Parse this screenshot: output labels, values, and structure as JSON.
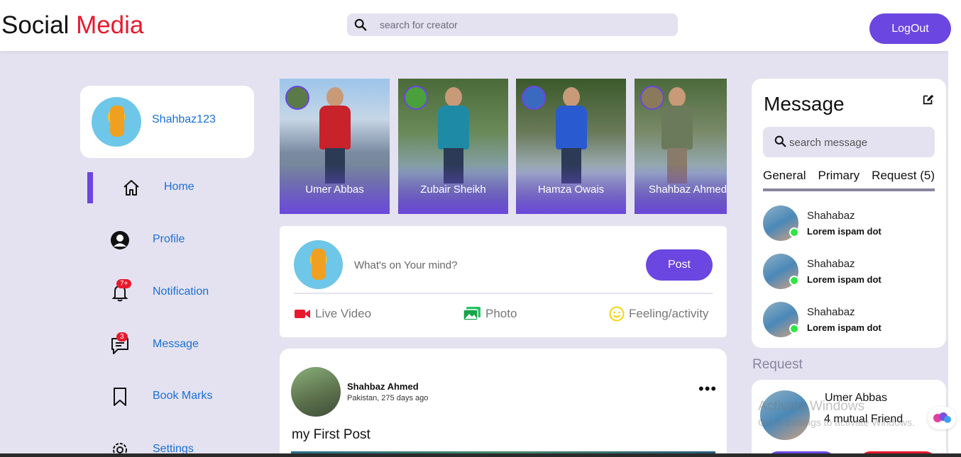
{
  "brand": {
    "part1": "Social",
    "part2": "Media"
  },
  "search": {
    "placeholder": "search for creator"
  },
  "header": {
    "logout_label": "LogOut"
  },
  "profile": {
    "username": "Shahbaz123"
  },
  "sidebar": {
    "items": [
      {
        "label": "Home",
        "icon": "home-icon",
        "active": true
      },
      {
        "label": "Profile",
        "icon": "user-icon"
      },
      {
        "label": "Notification",
        "icon": "bell-icon",
        "badge": "7+"
      },
      {
        "label": "Message",
        "icon": "chat-icon",
        "badge": "3"
      },
      {
        "label": "Book Marks",
        "icon": "bookmark-icon"
      },
      {
        "label": "Settings",
        "icon": "gear-icon"
      }
    ]
  },
  "stories": [
    {
      "name": "Umer Abbas"
    },
    {
      "name": "Zubair Sheikh"
    },
    {
      "name": "Hamza Owais"
    },
    {
      "name": "Shahbaz Ahmed"
    }
  ],
  "composer": {
    "placeholder": "What's on Your mind?",
    "post_label": "Post",
    "actions": [
      {
        "label": "Live Video",
        "icon": "video-icon",
        "color": "#e8192c"
      },
      {
        "label": "Photo",
        "icon": "photo-icon",
        "color": "#22c55e"
      },
      {
        "label": "Feeling/activity",
        "icon": "smile-icon",
        "color": "#f5d50a"
      }
    ]
  },
  "feed_post": {
    "author": "Shahbaz Ahmed",
    "meta": "Pakistan, 275 days ago",
    "text": "my First Post",
    "more_label": "•••"
  },
  "messages": {
    "title": "Message",
    "search_placeholder": "search message",
    "tabs": [
      "General",
      "Primary",
      "Request (5)"
    ],
    "items": [
      {
        "name": "Shahabaz",
        "text": "Lorem ispam dot",
        "online": true
      },
      {
        "name": "Shahabaz",
        "text": "Lorem ispam dot",
        "online": true
      },
      {
        "name": "Shahabaz",
        "text": "Lorem ispam dot",
        "online": true
      }
    ]
  },
  "requests": {
    "title": "Request",
    "item": {
      "name": "Umer Abbas",
      "mutual": "4 mutual Friend"
    }
  },
  "overlay": {
    "watermark_title": "Activate Windows",
    "watermark_sub": "Go to Settings to activate Windows."
  },
  "colors": {
    "accent": "#6b46e0",
    "brand_red": "#e8192c",
    "link": "#1a6fd6",
    "bg": "#e4e2f0",
    "online": "#2ee640"
  }
}
